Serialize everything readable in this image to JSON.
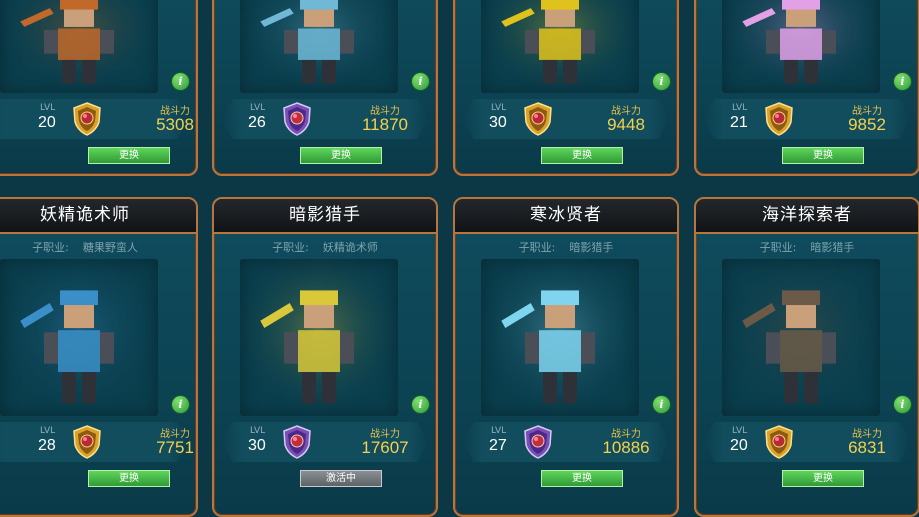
{
  "labels": {
    "subclass_key": "子职业:",
    "lvl": "LVL",
    "power": "战斗力",
    "info": "i"
  },
  "cards": [
    {
      "name": "",
      "subclass": "",
      "level": "20",
      "power": "5308",
      "button": "更换",
      "active": false,
      "badge": "gold-crest",
      "color": "#c0692a"
    },
    {
      "name": "",
      "subclass": "",
      "level": "26",
      "power": "11870",
      "button": "更换",
      "active": false,
      "badge": "purple-crest",
      "color": "#6fb8d6"
    },
    {
      "name": "",
      "subclass": "",
      "level": "30",
      "power": "9448",
      "button": "更换",
      "active": false,
      "badge": "gold-crest",
      "color": "#e0c21c"
    },
    {
      "name": "",
      "subclass": "",
      "level": "21",
      "power": "9852",
      "button": "更换",
      "active": false,
      "badge": "gold-crest",
      "color": "#e2a1e6"
    },
    {
      "name": "妖精诡术师",
      "subclass": "糖果野蛮人",
      "level": "28",
      "power": "7751",
      "button": "更换",
      "active": false,
      "badge": "gold-crest",
      "color": "#3b8fc8"
    },
    {
      "name": "暗影猎手",
      "subclass": "妖精诡术师",
      "level": "30",
      "power": "17607",
      "button": "激活中",
      "active": true,
      "badge": "purple-crest",
      "color": "#d9c83a"
    },
    {
      "name": "寒冰贤者",
      "subclass": "暗影猎手",
      "level": "27",
      "power": "10886",
      "button": "更换",
      "active": false,
      "badge": "purple-crest",
      "color": "#7fd4ee"
    },
    {
      "name": "海洋探索者",
      "subclass": "暗影猎手",
      "level": "20",
      "power": "6831",
      "button": "更换",
      "active": false,
      "badge": "gold-crest",
      "color": "#6b5a48"
    }
  ]
}
